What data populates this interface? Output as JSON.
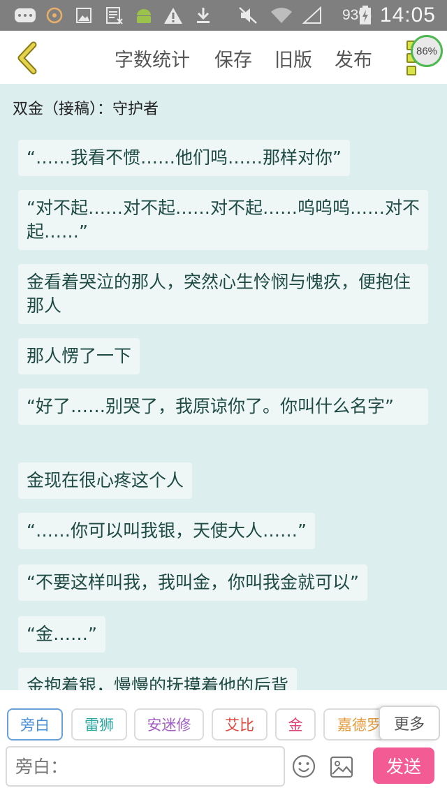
{
  "status_bar": {
    "icons": [
      "keyboard-icon",
      "browser-icon",
      "image-icon",
      "news-icon",
      "android-icon",
      "warning-icon",
      "download-icon",
      "mute-icon",
      "wifi-icon",
      "signal-icon",
      "battery-icon"
    ],
    "battery": "93%",
    "time": "14:05"
  },
  "toolbar": {
    "word_count": "字数统计",
    "save": "保存",
    "old_version": "旧版",
    "publish": "发布",
    "progress": "86%"
  },
  "doc": {
    "title": "双金（接稿）：守护者"
  },
  "messages": [
    "“……我看不惯……他们呜……那样对你”",
    "“对不起……对不起……对不起……呜呜呜……对不起……”",
    "金看着哭泣的那人，突然心生怜悯与愧疚，便抱住那人",
    "那人愣了一下",
    "“好了……别哭了，我原谅你了。你叫什么名字”",
    "金现在很心疼这个人",
    "“……你可以叫我银，天使大人……”",
    "“不要这样叫我，我叫金，你叫我金就可以”",
    "“金……”",
    "金抱着银，慢慢的抚摸着他的后背"
  ],
  "roles": [
    {
      "label": "旁白",
      "color": "#4a90d9"
    },
    {
      "label": "雷狮",
      "color": "#2aa6a0"
    },
    {
      "label": "安迷修",
      "color": "#a35ec4"
    },
    {
      "label": "艾比",
      "color": "#e0453a"
    },
    {
      "label": "金",
      "color": "#e0457a"
    },
    {
      "label": "嘉德罗斯",
      "color": "#e59a3a"
    }
  ],
  "more": "更多",
  "input": {
    "placeholder": "旁白："
  },
  "send": "发送",
  "colors": {
    "background": "#dceeed",
    "bubble": "#eef7f6",
    "bubble_text": "#1e4a44",
    "send": "#f25b93"
  }
}
